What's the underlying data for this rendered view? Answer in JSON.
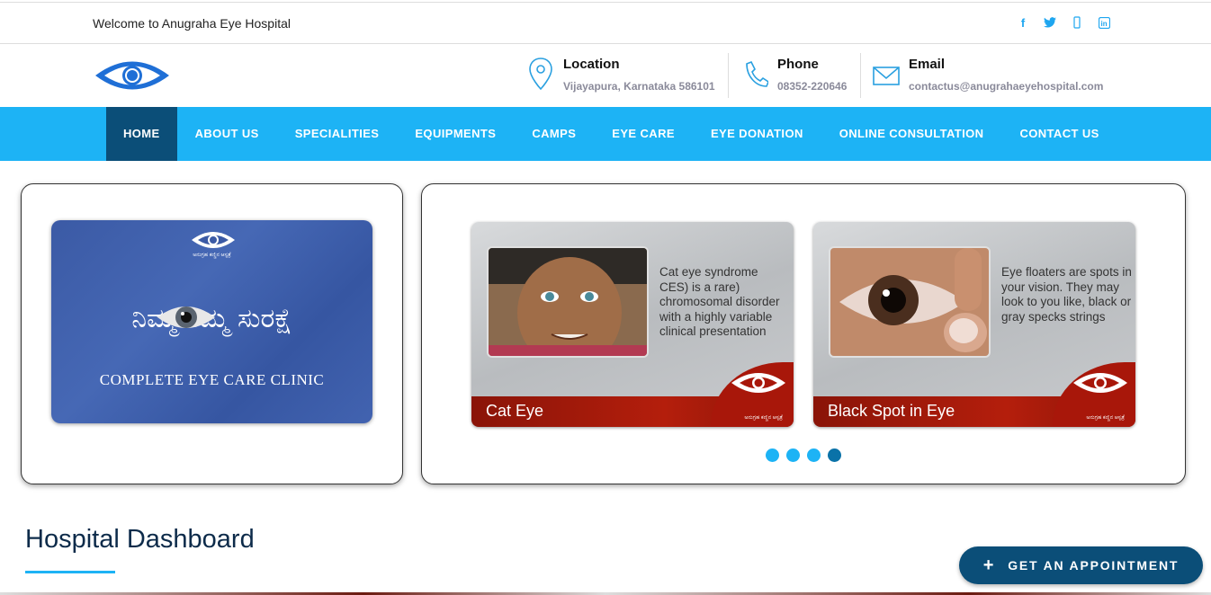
{
  "topbar": {
    "welcome": "Welcome to Anugraha Eye Hospital",
    "social_icons": [
      "facebook-icon",
      "twitter-icon",
      "instagram-icon",
      "linkedin-icon"
    ]
  },
  "header": {
    "location": {
      "title": "Location",
      "value": "Vijayapura, Karnataka 586101"
    },
    "phone": {
      "title": "Phone",
      "value": "08352-220646"
    },
    "email": {
      "title": "Email",
      "value": "contactus@anugrahaeyehospital.com"
    }
  },
  "nav": {
    "items": [
      "HOME",
      "ABOUT US",
      "SPECIALITIES",
      "EQUIPMENTS",
      "CAMPS",
      "EYE CARE",
      "EYE DONATION",
      "ONLINE CONSULTATION",
      "CONTACT US"
    ],
    "active": "HOME"
  },
  "hero": {
    "kannada_slogan": "ನಿಮ್ಮ        ನಮ್ಮ ಸುರಕ್ಷೆ",
    "clinic_caption": "COMPLETE EYE CARE CLINIC",
    "logo_caption": "ಅನುಗ್ರಹ ಕಣ್ಣಿನ ಆಸ್ಪತ್ರೆ"
  },
  "slides": [
    {
      "title": "Cat Eye",
      "description": "Cat eye syndrome CES) is a rare) chromosomal disorder with a highly variable clinical presentation",
      "logo_caption": "ಅನುಗ್ರಹ ಕಣ್ಣಿನ ಆಸ್ಪತ್ರೆ"
    },
    {
      "title": "Black Spot in Eye",
      "description": "Eye floaters are spots in your vision. They may look to you like, black or gray specks strings",
      "logo_caption": "ಅನುಗ್ರಹ ಕಣ್ಣಿನ ಆಸ್ಪತ್ರೆ"
    }
  ],
  "carousel": {
    "dot_count": 4,
    "active_dot": 4
  },
  "dashboard": {
    "title": "Hospital Dashboard"
  },
  "appointment": {
    "label": "GET AN APPOINTMENT"
  },
  "colors": {
    "nav_bg": "#1db3f5",
    "nav_active": "#0b4e78",
    "accent": "#1db3f5",
    "button_bg": "#0b4e78"
  }
}
